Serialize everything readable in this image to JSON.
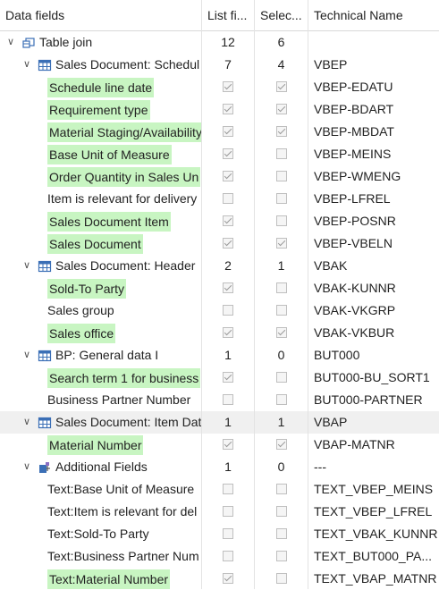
{
  "columns": {
    "data_fields": "Data fields",
    "list_fields": "List fi...",
    "selection": "Selec...",
    "technical_name": "Technical Name"
  },
  "rows": [
    {
      "level": 0,
      "kind": "join",
      "label": "Table join",
      "list": "12",
      "sel": "6",
      "tech": ""
    },
    {
      "level": 1,
      "kind": "table",
      "label": "Sales Document: Schedul",
      "list": "7",
      "sel": "4",
      "tech": "VBEP"
    },
    {
      "level": 2,
      "kind": "field",
      "label": "Schedule line date",
      "hl": true,
      "list_checked": true,
      "sel_checked": true,
      "tech": "VBEP-EDATU"
    },
    {
      "level": 2,
      "kind": "field",
      "label": "Requirement type",
      "hl": true,
      "list_checked": true,
      "sel_checked": true,
      "tech": "VBEP-BDART"
    },
    {
      "level": 2,
      "kind": "field",
      "label": "Material Staging/Availability",
      "hl": true,
      "list_checked": true,
      "sel_checked": true,
      "tech": "VBEP-MBDAT"
    },
    {
      "level": 2,
      "kind": "field",
      "label": "Base Unit of Measure",
      "hl": true,
      "list_checked": true,
      "sel_checked": false,
      "tech": "VBEP-MEINS"
    },
    {
      "level": 2,
      "kind": "field",
      "label": "Order Quantity in Sales Un",
      "hl": true,
      "list_checked": true,
      "sel_checked": false,
      "tech": "VBEP-WMENG"
    },
    {
      "level": 2,
      "kind": "field",
      "label": "Item is relevant for delivery",
      "hl": false,
      "list_checked": false,
      "sel_checked": false,
      "tech": "VBEP-LFREL"
    },
    {
      "level": 2,
      "kind": "field",
      "label": "Sales Document Item",
      "hl": true,
      "list_checked": true,
      "sel_checked": false,
      "tech": "VBEP-POSNR"
    },
    {
      "level": 2,
      "kind": "field",
      "label": "Sales Document",
      "hl": true,
      "list_checked": true,
      "sel_checked": true,
      "tech": "VBEP-VBELN"
    },
    {
      "level": 1,
      "kind": "table",
      "label": "Sales Document: Header",
      "list": "2",
      "sel": "1",
      "tech": "VBAK"
    },
    {
      "level": 2,
      "kind": "field",
      "label": "Sold-To Party",
      "hl": true,
      "list_checked": true,
      "sel_checked": false,
      "tech": "VBAK-KUNNR"
    },
    {
      "level": 2,
      "kind": "field",
      "label": "Sales group",
      "hl": false,
      "list_checked": false,
      "sel_checked": false,
      "tech": "VBAK-VKGRP"
    },
    {
      "level": 2,
      "kind": "field",
      "label": "Sales office",
      "hl": true,
      "list_checked": true,
      "sel_checked": true,
      "tech": "VBAK-VKBUR"
    },
    {
      "level": 1,
      "kind": "table",
      "label": "BP: General data I",
      "list": "1",
      "sel": "0",
      "tech": "BUT000"
    },
    {
      "level": 2,
      "kind": "field",
      "label": "Search term 1 for business",
      "hl": true,
      "list_checked": true,
      "sel_checked": false,
      "tech": "BUT000-BU_SORT1"
    },
    {
      "level": 2,
      "kind": "field",
      "label": "Business Partner Number",
      "hl": false,
      "list_checked": false,
      "sel_checked": false,
      "tech": "BUT000-PARTNER"
    },
    {
      "level": 1,
      "kind": "table",
      "label": "Sales Document: Item Dat",
      "list": "1",
      "sel": "1",
      "tech": "VBAP",
      "selected": true
    },
    {
      "level": 2,
      "kind": "field",
      "label": "Material Number",
      "hl": true,
      "list_checked": true,
      "sel_checked": true,
      "tech": "VBAP-MATNR"
    },
    {
      "level": 1,
      "kind": "additional",
      "label": "Additional Fields",
      "list": "1",
      "sel": "0",
      "tech": "---"
    },
    {
      "level": 2,
      "kind": "field",
      "label": "Text:Base Unit of Measure",
      "hl": false,
      "list_checked": false,
      "sel_checked": false,
      "tech": "TEXT_VBEP_MEINS"
    },
    {
      "level": 2,
      "kind": "field",
      "label": "Text:Item is relevant for del",
      "hl": false,
      "list_checked": false,
      "sel_checked": false,
      "tech": "TEXT_VBEP_LFREL"
    },
    {
      "level": 2,
      "kind": "field",
      "label": "Text:Sold-To Party",
      "hl": false,
      "list_checked": false,
      "sel_checked": false,
      "tech": "TEXT_VBAK_KUNNR"
    },
    {
      "level": 2,
      "kind": "field",
      "label": "Text:Business Partner Num",
      "hl": false,
      "list_checked": false,
      "sel_checked": false,
      "tech": "TEXT_BUT000_PA..."
    },
    {
      "level": 2,
      "kind": "field",
      "label": "Text:Material Number",
      "hl": true,
      "list_checked": true,
      "sel_checked": false,
      "tech": "TEXT_VBAP_MATNR"
    }
  ],
  "icons": {
    "join": "table-join-icon",
    "table": "table-grid-icon",
    "additional": "additional-fields-icon",
    "expand": "chevron-down-icon"
  },
  "colors": {
    "highlight": "#c8f5c2",
    "selected_row": "#f0f0f0",
    "icon_blue": "#3b6fb6"
  }
}
